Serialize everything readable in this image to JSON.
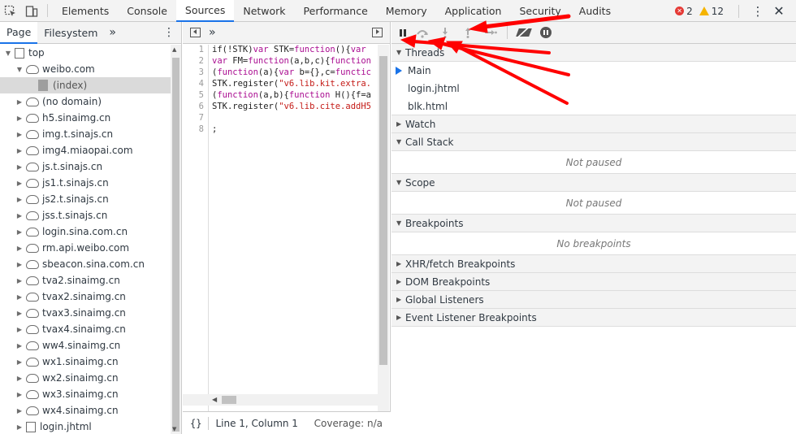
{
  "topbar": {
    "tabs": [
      {
        "label": "Elements",
        "active": false
      },
      {
        "label": "Console",
        "active": false
      },
      {
        "label": "Sources",
        "active": true
      },
      {
        "label": "Network",
        "active": false
      },
      {
        "label": "Performance",
        "active": false
      },
      {
        "label": "Memory",
        "active": false
      },
      {
        "label": "Application",
        "active": false
      },
      {
        "label": "Security",
        "active": false
      },
      {
        "label": "Audits",
        "active": false
      }
    ],
    "error_count": "2",
    "warning_count": "12",
    "icons": [
      "inspect-icon",
      "device-toolbar-icon",
      "error-icon",
      "warning-icon",
      "kebab-icon",
      "close-icon"
    ]
  },
  "navigator": {
    "tabs": [
      {
        "label": "Page",
        "active": true
      },
      {
        "label": "Filesystem",
        "active": false
      }
    ],
    "more": "»",
    "tree": [
      {
        "label": "top",
        "depth": 0,
        "icon": "page",
        "expanded": true
      },
      {
        "label": "weibo.com",
        "depth": 1,
        "icon": "cloud",
        "expanded": true
      },
      {
        "label": "(index)",
        "depth": 2,
        "icon": "file",
        "selected": true
      },
      {
        "label": "(no domain)",
        "depth": 1,
        "icon": "cloud",
        "expanded": false
      },
      {
        "label": "h5.sinaimg.cn",
        "depth": 1,
        "icon": "cloud",
        "expanded": false
      },
      {
        "label": "img.t.sinajs.cn",
        "depth": 1,
        "icon": "cloud",
        "expanded": false
      },
      {
        "label": "img4.miaopai.com",
        "depth": 1,
        "icon": "cloud",
        "expanded": false
      },
      {
        "label": "js.t.sinajs.cn",
        "depth": 1,
        "icon": "cloud",
        "expanded": false
      },
      {
        "label": "js1.t.sinajs.cn",
        "depth": 1,
        "icon": "cloud",
        "expanded": false
      },
      {
        "label": "js2.t.sinajs.cn",
        "depth": 1,
        "icon": "cloud",
        "expanded": false
      },
      {
        "label": "jss.t.sinajs.cn",
        "depth": 1,
        "icon": "cloud",
        "expanded": false
      },
      {
        "label": "login.sina.com.cn",
        "depth": 1,
        "icon": "cloud",
        "expanded": false
      },
      {
        "label": "rm.api.weibo.com",
        "depth": 1,
        "icon": "cloud",
        "expanded": false
      },
      {
        "label": "sbeacon.sina.com.cn",
        "depth": 1,
        "icon": "cloud",
        "expanded": false
      },
      {
        "label": "tva2.sinaimg.cn",
        "depth": 1,
        "icon": "cloud",
        "expanded": false
      },
      {
        "label": "tvax2.sinaimg.cn",
        "depth": 1,
        "icon": "cloud",
        "expanded": false
      },
      {
        "label": "tvax3.sinaimg.cn",
        "depth": 1,
        "icon": "cloud",
        "expanded": false
      },
      {
        "label": "tvax4.sinaimg.cn",
        "depth": 1,
        "icon": "cloud",
        "expanded": false
      },
      {
        "label": "ww4.sinaimg.cn",
        "depth": 1,
        "icon": "cloud",
        "expanded": false
      },
      {
        "label": "wx1.sinaimg.cn",
        "depth": 1,
        "icon": "cloud",
        "expanded": false
      },
      {
        "label": "wx2.sinaimg.cn",
        "depth": 1,
        "icon": "cloud",
        "expanded": false
      },
      {
        "label": "wx3.sinaimg.cn",
        "depth": 1,
        "icon": "cloud",
        "expanded": false
      },
      {
        "label": "wx4.sinaimg.cn",
        "depth": 1,
        "icon": "cloud",
        "expanded": false
      },
      {
        "label": "login.jhtml",
        "depth": 1,
        "icon": "page",
        "expanded": false
      }
    ]
  },
  "editor": {
    "more": "»",
    "lines": [
      [
        {
          "t": "if(!STK)",
          "c": ""
        },
        {
          "t": "var",
          "c": "kw"
        },
        {
          "t": " STK=",
          "c": ""
        },
        {
          "t": "function",
          "c": "kw"
        },
        {
          "t": "(){",
          "c": ""
        },
        {
          "t": "var",
          "c": "kw"
        }
      ],
      [
        {
          "t": "var",
          "c": "kw"
        },
        {
          "t": " FM=",
          "c": ""
        },
        {
          "t": "function",
          "c": "kw"
        },
        {
          "t": "(a,b,c){",
          "c": ""
        },
        {
          "t": "function",
          "c": "kw"
        }
      ],
      [
        {
          "t": "(",
          "c": ""
        },
        {
          "t": "function",
          "c": "kw"
        },
        {
          "t": "(a){",
          "c": ""
        },
        {
          "t": "var",
          "c": "kw"
        },
        {
          "t": " b={},c=",
          "c": ""
        },
        {
          "t": "functic",
          "c": "kw"
        }
      ],
      [
        {
          "t": "STK.register(",
          "c": ""
        },
        {
          "t": "\"v6.lib.kit.extra.",
          "c": "str"
        }
      ],
      [
        {
          "t": "(",
          "c": ""
        },
        {
          "t": "function",
          "c": "kw"
        },
        {
          "t": "(a,b){",
          "c": ""
        },
        {
          "t": "function",
          "c": "kw"
        },
        {
          "t": " H(){f=a",
          "c": ""
        }
      ],
      [
        {
          "t": "STK.register(",
          "c": ""
        },
        {
          "t": "\"v6.lib.cite.addH5",
          "c": "str"
        }
      ],
      [
        {
          "t": "",
          "c": ""
        }
      ],
      [
        {
          "t": ";",
          "c": ""
        }
      ]
    ],
    "status": {
      "braces": "{}",
      "position": "Line 1, Column 1",
      "coverage": "Coverage: n/a"
    }
  },
  "debugger": {
    "sections": {
      "threads": {
        "label": "Threads",
        "items": [
          {
            "label": "Main",
            "current": true
          },
          {
            "label": "login.jhtml",
            "current": false
          },
          {
            "label": "blk.html",
            "current": false
          }
        ]
      },
      "watch": {
        "label": "Watch"
      },
      "call_stack": {
        "label": "Call Stack",
        "placeholder": "Not paused"
      },
      "scope": {
        "label": "Scope",
        "placeholder": "Not paused"
      },
      "breakpoints": {
        "label": "Breakpoints",
        "placeholder": "No breakpoints"
      },
      "xhr": {
        "label": "XHR/fetch Breakpoints"
      },
      "dom": {
        "label": "DOM Breakpoints"
      },
      "global": {
        "label": "Global Listeners"
      },
      "event": {
        "label": "Event Listener Breakpoints"
      }
    },
    "toolbar_icons": [
      "pause-icon",
      "step-over-icon",
      "step-into-icon",
      "step-out-icon",
      "step-icon",
      "deactivate-breakpoints-icon",
      "pause-on-exceptions-icon"
    ]
  },
  "colors": {
    "accent": "#1a73e8",
    "annotation_arrow": "#ff0000",
    "error": "#e53935",
    "warning": "#f5b400"
  }
}
